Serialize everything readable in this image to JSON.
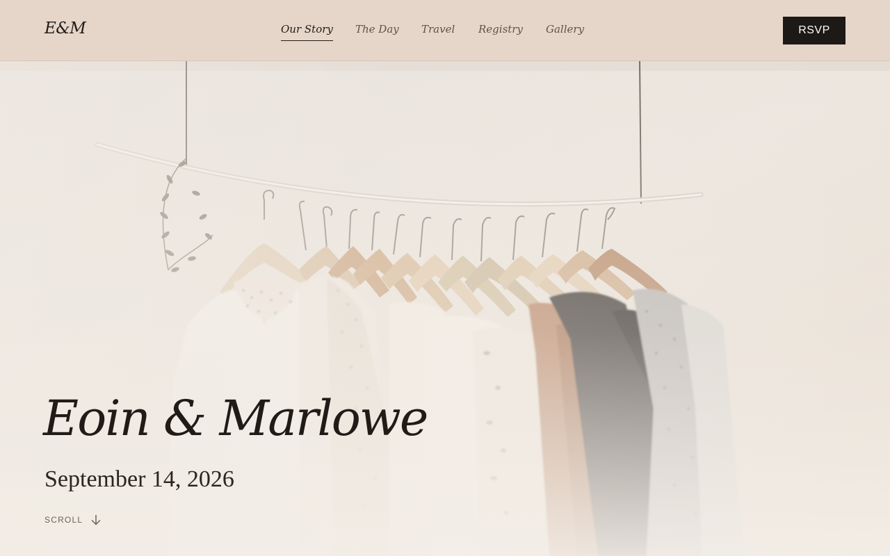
{
  "header": {
    "logo": "E&M",
    "nav": [
      {
        "label": "Our Story",
        "active": true
      },
      {
        "label": "The Day",
        "active": false
      },
      {
        "label": "Travel",
        "active": false
      },
      {
        "label": "Registry",
        "active": false
      },
      {
        "label": "Gallery",
        "active": false
      }
    ],
    "rsvp_label": "RSVP"
  },
  "hero": {
    "names": "Eoin & Marlowe",
    "date": "September 14, 2026",
    "scroll_label": "SCROLL",
    "scroll_icon": "arrow-down-icon"
  },
  "colors": {
    "header_bg": "#e6d6c9",
    "button_bg": "#1c1916",
    "text_dark": "#1f1b17",
    "hero_bg": "#efe8df"
  }
}
